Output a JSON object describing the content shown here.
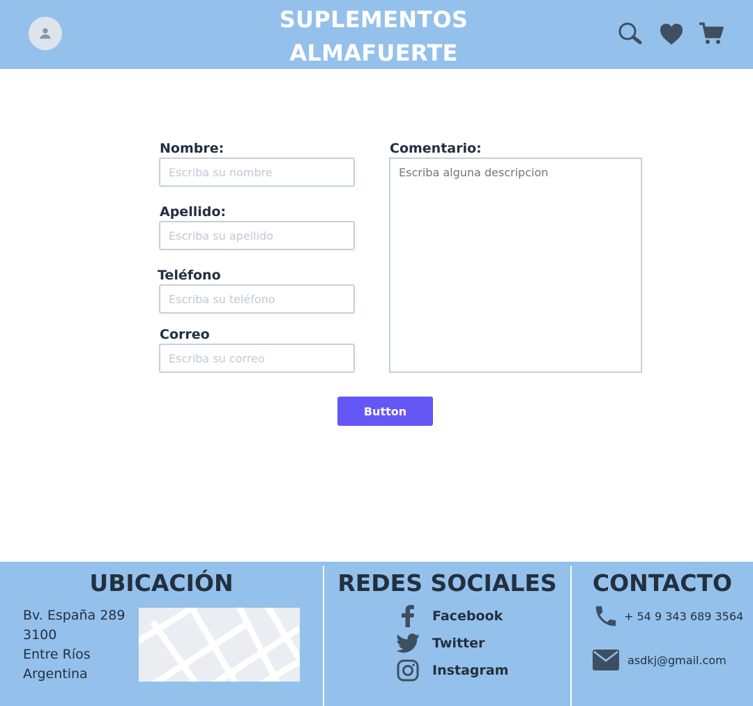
{
  "header": {
    "brand_line1": "SUPLEMENTOS",
    "brand_line2": "ALMAFUERTE",
    "icons": [
      "user-icon",
      "search-icon",
      "heart-icon",
      "cart-icon"
    ],
    "background": "#94c1eb"
  },
  "form": {
    "nombre": {
      "label": "Nombre:",
      "placeholder": "Escriba su nombre"
    },
    "apellido": {
      "label": "Apellido:",
      "placeholder": "Escriba su apellido"
    },
    "telefono": {
      "label": "Teléfono",
      "placeholder": "Escriba su teléfono"
    },
    "correo": {
      "label": "Correo",
      "placeholder": "Escriba su correo"
    },
    "comentario": {
      "label": "Comentario:",
      "placeholder": "Escriba alguna descripcion"
    },
    "button_label": "Button",
    "button_color": "#6557f5"
  },
  "footer": {
    "ubicacion": {
      "title": "UBICACIÓN",
      "address": [
        "Bv. España 289",
        "3100",
        "Entre Ríos",
        "Argentina"
      ]
    },
    "redes": {
      "title": "REDES SOCIALES",
      "items": [
        {
          "label": "Facebook",
          "icon": "facebook-icon"
        },
        {
          "label": "Twitter",
          "icon": "twitter-icon"
        },
        {
          "label": "Instagram",
          "icon": "instagram-icon"
        }
      ]
    },
    "contacto": {
      "title": "CONTACTO",
      "phone": "+ 54 9 343 689 3564",
      "email": "asdkj@gmail.com"
    }
  }
}
